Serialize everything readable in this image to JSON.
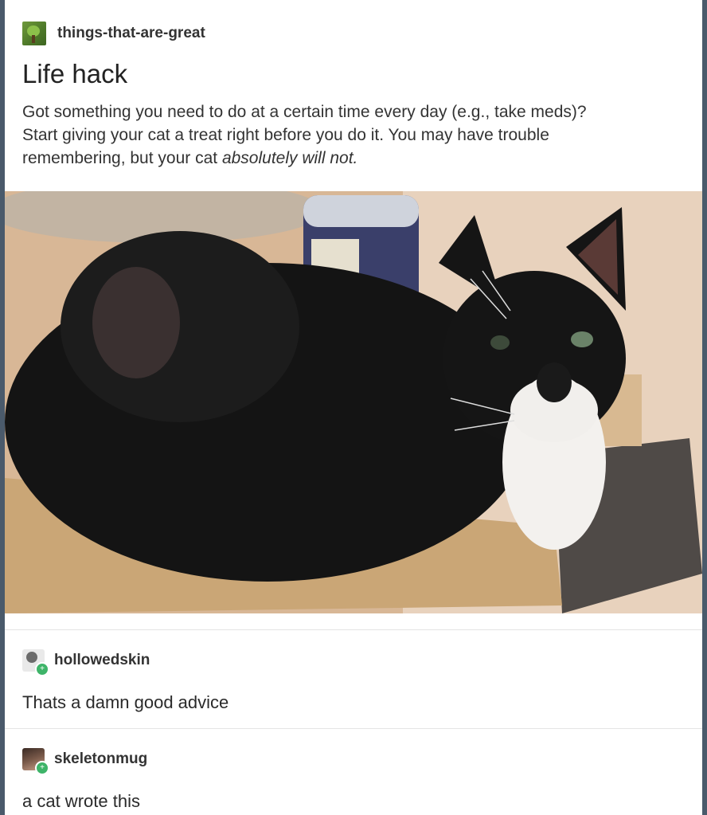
{
  "post": {
    "blog_name": "things-that-are-great",
    "blog_avatar_icon": "tree-avatar-icon",
    "title": "Life hack",
    "body_line_1": "Got something you need to do at a certain time every day (e.g., take meds)?",
    "body_line_2": "Start giving your cat a treat right before you do it.  You may have trouble",
    "body_line_3_prefix": "remembering, but your cat ",
    "body_line_3_emphasis": "absolutely will not.",
    "photo_description_icon": "tuxedo-cat-photo"
  },
  "reblogs": [
    {
      "username": "hollowedskin",
      "avatar_icon": "skull-avatar-icon",
      "text": "Thats a damn good advice"
    },
    {
      "username": "skeletonmug",
      "avatar_icon": "portrait-avatar-icon",
      "text": "a cat wrote this"
    }
  ],
  "colors": {
    "follow_badge": "#3eb469",
    "text": "#333333"
  }
}
